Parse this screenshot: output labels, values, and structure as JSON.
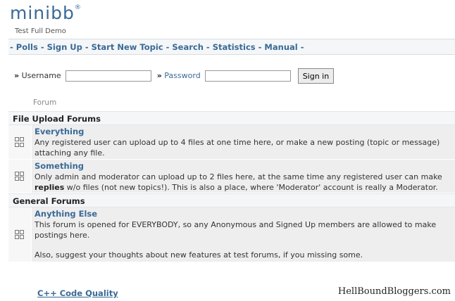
{
  "header": {
    "logo": "minibb",
    "logo_mark": "®",
    "subtitle": "Test Full Demo"
  },
  "nav": {
    "items": [
      "Polls",
      "Sign Up",
      "Start New Topic",
      "Search",
      "Statistics",
      "Manual"
    ]
  },
  "login": {
    "username_label": "Username",
    "password_label": "Password",
    "username_value": "",
    "password_value": "",
    "submit_label": "Sign in"
  },
  "forum_column_header": "Forum",
  "sections": [
    {
      "title": "File Upload Forums",
      "forums": [
        {
          "name": "Everything",
          "description": "Any registered user can upload up to 4 files at one time here, or make a new posting (topic or message) attaching any file."
        },
        {
          "name": "Something",
          "description_before": "Only admin and moderator can upload up to 2 files here, at the same time any registered user can make ",
          "description_bold": "replies",
          "description_after": " w/o files (not new topics!). This is also a place, where 'Moderator' account is really a Moderator."
        }
      ]
    },
    {
      "title": "General Forums",
      "forums": [
        {
          "name": "Anything Else",
          "description": "This forum is opened for EVERYBODY, so any Anonymous and Signed Up members are allowed to make postings here.",
          "description_extra": "Also, suggest your thoughts about new features at test forums, if you missing some."
        }
      ]
    }
  ],
  "footer_link": "C++ Code Quality",
  "watermark": "HellBoundBloggers.com"
}
